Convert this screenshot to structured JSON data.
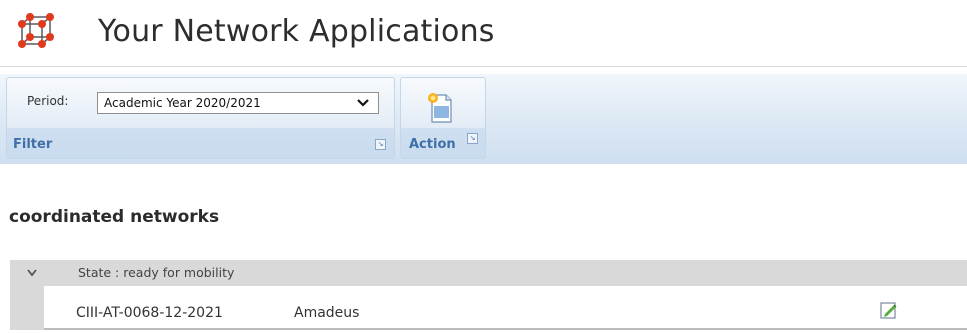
{
  "header": {
    "title": "Your Network Applications",
    "logo_icon": "network-cube-icon"
  },
  "ribbon": {
    "filter_group": {
      "label": "Filter",
      "period_label": "Period:",
      "period_value": "Academic Year 2020/2021",
      "launcher_icon": "dialog-launcher-icon"
    },
    "action_group": {
      "label": "Action",
      "icon": "new-document-icon",
      "launcher_icon": "dialog-launcher-icon"
    }
  },
  "section": {
    "title": "coordinated networks",
    "group_header": "State : ready for mobility",
    "rows": [
      {
        "code": "CIII-AT-0068-12-2021",
        "name": "Amadeus",
        "action_icon": "edit-icon"
      }
    ]
  },
  "colors": {
    "ribbon_label": "#3f6fa8",
    "logo_red": "#e03a1e",
    "row_header_bg": "#d9d9d9"
  }
}
